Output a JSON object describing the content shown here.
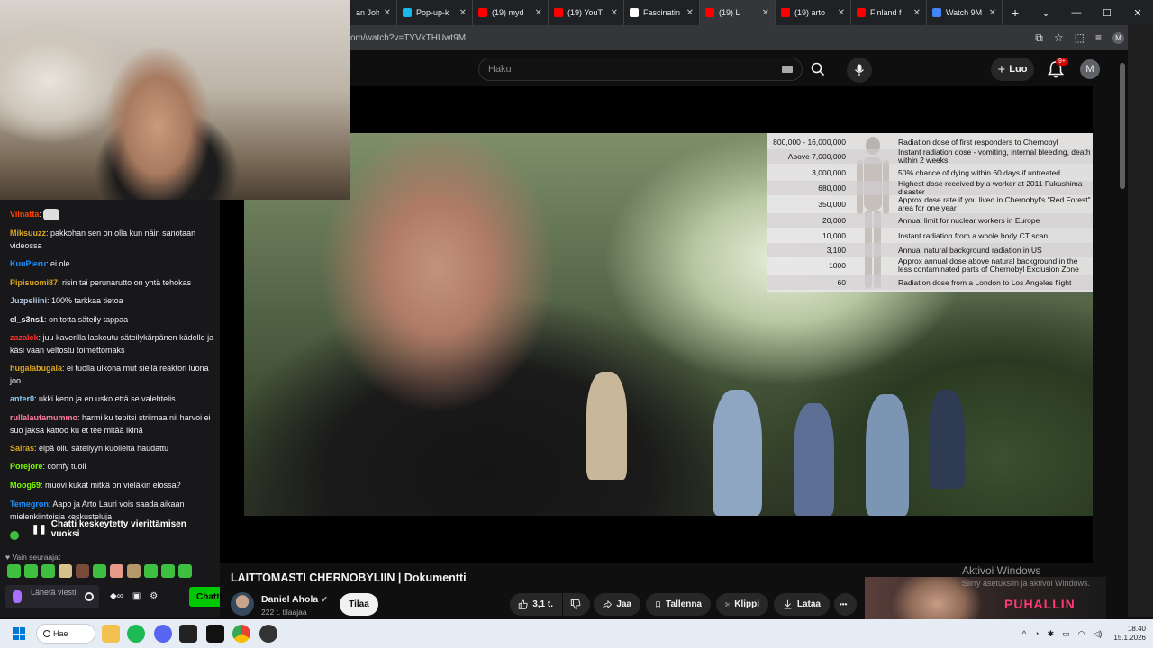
{
  "browser": {
    "tabs": [
      {
        "title": "an Joh",
        "favicon_color": "#ffffff",
        "active": false
      },
      {
        "title": "Pop-up-k",
        "favicon_color": "#1ab7ea",
        "active": false
      },
      {
        "title": "(19) myd",
        "favicon_color": "#ff0000",
        "active": false
      },
      {
        "title": "(19) YouT",
        "favicon_color": "#ff0000",
        "active": false
      },
      {
        "title": "Fascinatin",
        "favicon_color": "#ffffff",
        "active": false
      },
      {
        "title": "(19) L",
        "favicon_color": "#ff0000",
        "active": true
      },
      {
        "title": "(19) arto",
        "favicon_color": "#ff0000",
        "active": false
      },
      {
        "title": "Finland f",
        "favicon_color": "#ff0000",
        "active": false
      },
      {
        "title": "Watch 9M",
        "favicon_color": "#4285f4",
        "active": false
      }
    ],
    "new_tab": "+",
    "url": "om/watch?v=TYVkTHUwt9M",
    "profile_initial": "M"
  },
  "youtube": {
    "search_placeholder": "Haku",
    "create_label": "Luo",
    "notif_count": "9+",
    "avatar_initial": "M"
  },
  "radiation_chart": {
    "rows": [
      {
        "value": "800,000 - 16,000,000",
        "desc": "Radiation dose of first responders to Chernobyl"
      },
      {
        "value": "Above 7,000,000",
        "desc": "Instant radiation dose - vomiting, internal bleeding, death within 2 weeks"
      },
      {
        "value": "3,000,000",
        "desc": "50% chance of dying within 60 days if untreated"
      },
      {
        "value": "680,000",
        "desc": "Highest dose received by a worker at 2011 Fukushima disaster"
      },
      {
        "value": "350,000",
        "desc": "Approx dose rate if you lived in Chernobyl's \"Red Forest\" area for one year"
      },
      {
        "value": "20,000",
        "desc": "Annual limit for nuclear workers in Europe"
      },
      {
        "value": "10,000",
        "desc": "Instant radiation from a whole body CT scan"
      },
      {
        "value": "3,100",
        "desc": "Annual natural background radiation in US"
      },
      {
        "value": "1000",
        "desc": "Approx annual dose above natural background in the less contaminated parts of Chernobyl Exclusion Zone"
      },
      {
        "value": "60",
        "desc": "Radiation dose from a London to Los Angeles flight"
      }
    ]
  },
  "chat": {
    "messages": [
      {
        "user": "Vilnatta",
        "color": "#ff4500",
        "text": "",
        "emote": true
      },
      {
        "user": "Miksuuzz",
        "color": "#daa520",
        "text": "pakkohan sen on olla kun näin sanotaan videossa"
      },
      {
        "user": "KuuPieru",
        "color": "#1e90ff",
        "text": "ei ole"
      },
      {
        "user": "Pipisuomi87",
        "color": "#daa520",
        "text": "risin tai perunarutto on yhtä tehokas"
      },
      {
        "user": "Juzpeliini",
        "color": "#b0c4de",
        "text": "100% tarkkaa tietoa"
      },
      {
        "user": "el_s3ns1",
        "color": "#efeff1",
        "text": "on totta säteily tappaa"
      },
      {
        "user": "zazalek",
        "color": "#ff3030",
        "text": "juu kaverilla laskeutu säteilykärpänen kädelle ja käsi vaan veltostu toimettomaks"
      },
      {
        "user": "hugalabugala",
        "color": "#daa520",
        "text": "ei tuolla ulkona mut siellä reaktori luona joo"
      },
      {
        "user": "anter0",
        "color": "#87cefa",
        "text": "ukki kerto ja en usko että se valehtelis"
      },
      {
        "user": "rullalautamummo",
        "color": "#ff7fa0",
        "text": "harmi ku tepitsi striimaa nii harvoi ei suo jaksa kattoo ku et tee mitää ikinä"
      },
      {
        "user": "Sairas",
        "color": "#daa520",
        "text": "eipä ollu säteilyyn kuolleita haudattu"
      },
      {
        "user": "Porejore",
        "color": "#7cfc00",
        "text": "comfy tuoli"
      },
      {
        "user": "Moog69",
        "color": "#7cfc00",
        "text": "muovi kukat mitkä on vieläkin elossa?"
      },
      {
        "user": "Temegron",
        "color": "#1e90ff",
        "text": "Aapo ja Arto Lauri vois saada aikaan mielenkiintoisia keskusteluja"
      }
    ],
    "paused_text": "Chatti keskeytetty vierittämisen vuoksi",
    "replying_to_label": "Vain seuraajat",
    "input_placeholder": "Lähetä viesti",
    "chat_button": "Chatti"
  },
  "video": {
    "title": "LAITTOMASTI CHERNOBYLIIN | Dokumentti",
    "channel": "Daniel Ahola",
    "subs": "222 t. tilaajaa",
    "subscribe_label": "Tilaa",
    "likes": "3,1 t.",
    "share_label": "Jaa",
    "save_label": "Tallenna",
    "clip_label": "Klippi",
    "download_label": "Lataa",
    "more_label": "•••"
  },
  "overlay": {
    "activate_title": "Aktivoi Windows",
    "activate_sub": "Siirry asetuksiin ja aktivoi Windows.",
    "thumb_logo": "PUHALLIN"
  },
  "taskbar": {
    "search_label": "Hae",
    "time": "18.40",
    "date": "15.1.2026"
  },
  "colors": {
    "youtube_bg": "#0f0f0f",
    "twitch_chat_bg": "#18181b",
    "chat_button_bg": "#00c800",
    "twitch_purple": "#a970ff"
  }
}
